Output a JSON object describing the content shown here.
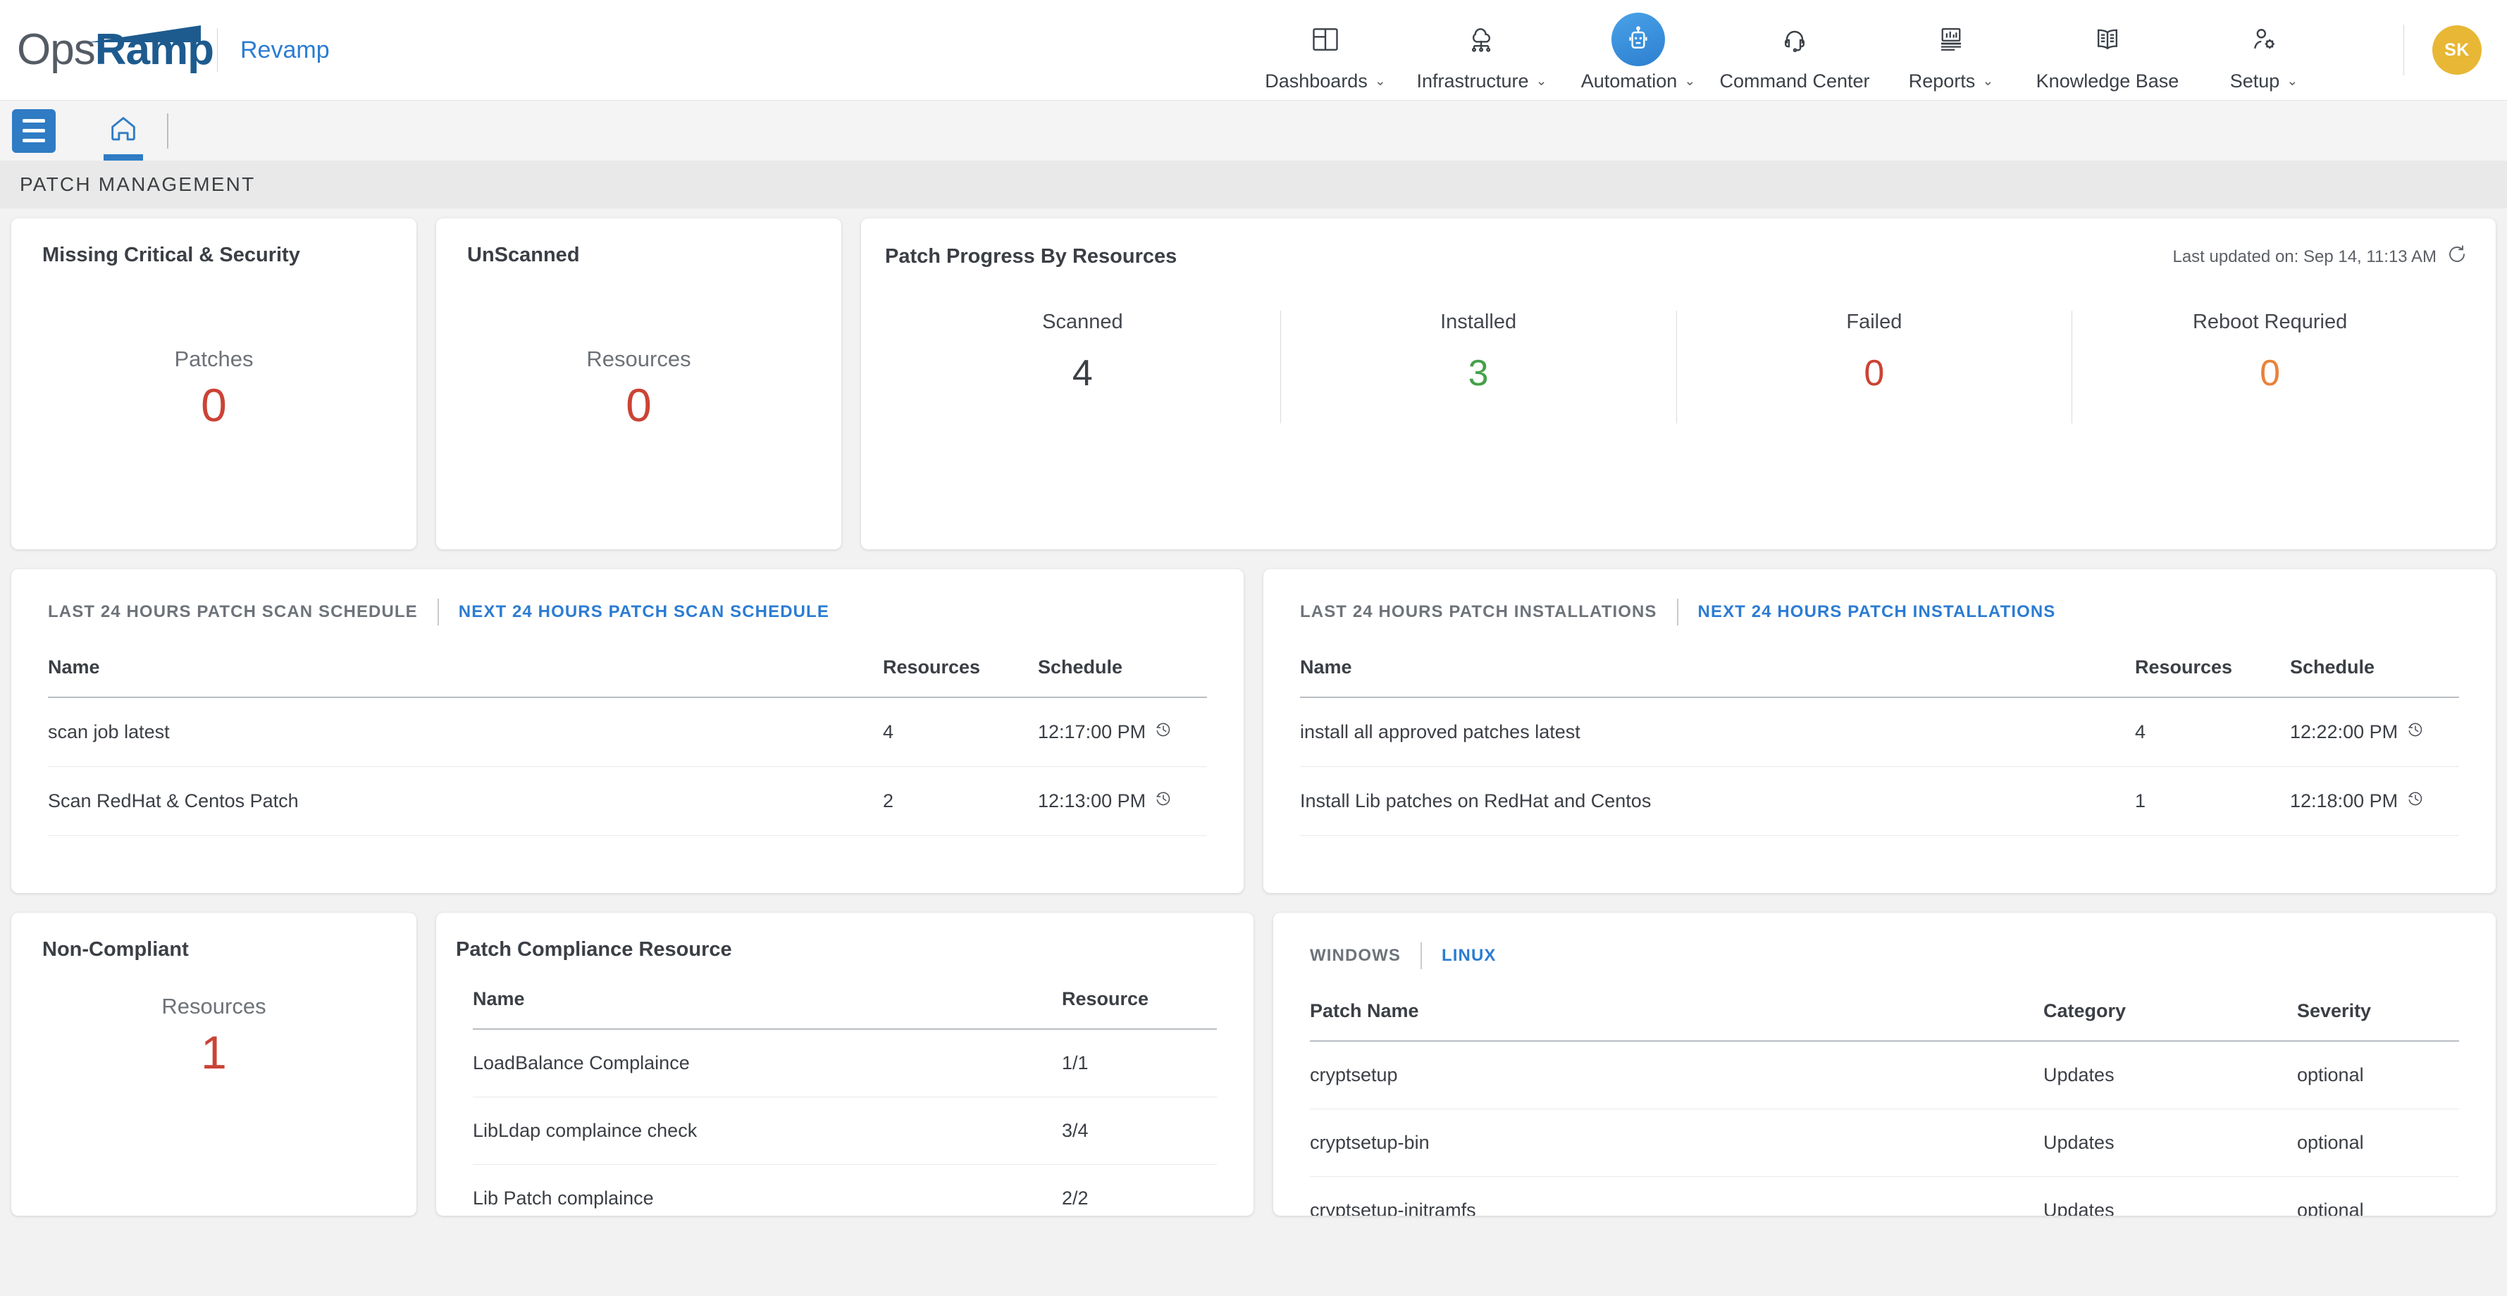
{
  "brand": {
    "name_light": "Ops",
    "name_bold": "Ramp",
    "sub": "Revamp"
  },
  "topnav": {
    "items": [
      {
        "label": "Dashboards",
        "icon": "dashboard-icon",
        "caret": "⌄",
        "active": false
      },
      {
        "label": "Infrastructure",
        "icon": "infrastructure-icon",
        "caret": "⌄",
        "active": false
      },
      {
        "label": "Automation",
        "icon": "robot-icon",
        "caret": "⌄",
        "active": true
      },
      {
        "label": "Command Center",
        "icon": "headset-icon",
        "caret": "",
        "active": false
      },
      {
        "label": "Reports",
        "icon": "report-icon",
        "caret": "⌄",
        "active": false
      },
      {
        "label": "Knowledge Base",
        "icon": "book-icon",
        "caret": "",
        "active": false
      },
      {
        "label": "Setup",
        "icon": "user-gear-icon",
        "caret": "⌄",
        "active": false
      }
    ],
    "avatar_initials": "SK",
    "avatar_color": "#e8b735"
  },
  "subbar": {
    "menu_icon": "hamburger-icon",
    "home_icon": "home-icon"
  },
  "page": {
    "title": "PATCH MANAGEMENT"
  },
  "colors": {
    "red": "#cb4335",
    "green": "#45a049",
    "orange": "#e8833a",
    "dark": "#3b3f45",
    "link": "#2b7cd3"
  },
  "kpi_cards": [
    {
      "title": "Missing Critical & Security",
      "label": "Patches",
      "value": "0",
      "color": "#cb4335"
    },
    {
      "title": "UnScanned",
      "label": "Resources",
      "value": "0",
      "color": "#cb4335"
    }
  ],
  "progress": {
    "title": "Patch Progress By Resources",
    "updated_text": "Last updated on: Sep 14, 11:13 AM",
    "refresh_icon": "refresh-icon",
    "stats": [
      {
        "label": "Scanned",
        "value": "4",
        "color": "#3b3f45"
      },
      {
        "label": "Installed",
        "value": "3",
        "color": "#45a049"
      },
      {
        "label": "Failed",
        "value": "0",
        "color": "#cb4335"
      },
      {
        "label": "Reboot Requried",
        "value": "0",
        "color": "#e8833a"
      }
    ]
  },
  "scan_schedule": {
    "tabs": [
      {
        "label": "LAST 24 HOURS PATCH SCAN SCHEDULE",
        "active": false
      },
      {
        "label": "NEXT 24 HOURS PATCH SCAN SCHEDULE",
        "active": true
      }
    ],
    "columns": [
      "Name",
      "Resources",
      "Schedule"
    ],
    "rows": [
      {
        "name": "scan job latest",
        "resources": "4",
        "schedule": "12:17:00 PM"
      },
      {
        "name": "Scan RedHat & Centos Patch",
        "resources": "2",
        "schedule": "12:13:00 PM"
      }
    ]
  },
  "installations": {
    "tabs": [
      {
        "label": "LAST 24 HOURS PATCH INSTALLATIONS",
        "active": false
      },
      {
        "label": "NEXT 24 HOURS PATCH INSTALLATIONS",
        "active": true
      }
    ],
    "columns": [
      "Name",
      "Resources",
      "Schedule"
    ],
    "rows": [
      {
        "name": "install all approved patches latest",
        "resources": "4",
        "schedule": "12:22:00 PM"
      },
      {
        "name": "Install Lib patches on RedHat and Centos",
        "resources": "1",
        "schedule": "12:18:00 PM"
      }
    ]
  },
  "non_compliant": {
    "title": "Non-Compliant",
    "label": "Resources",
    "value": "1",
    "color": "#cb4335"
  },
  "compliance_resource": {
    "title": "Patch Compliance Resource",
    "columns": [
      "Name",
      "Resource"
    ],
    "rows": [
      {
        "name": "LoadBalance Complaince",
        "resource": "1/1"
      },
      {
        "name": "LibLdap complaince check",
        "resource": "3/4"
      },
      {
        "name": "Lib Patch complaince",
        "resource": "2/2"
      }
    ]
  },
  "os_patches": {
    "tabs": [
      {
        "label": "WINDOWS",
        "active": false
      },
      {
        "label": "LINUX",
        "active": true
      }
    ],
    "columns": [
      "Patch Name",
      "Category",
      "Severity"
    ],
    "rows": [
      {
        "name": "cryptsetup",
        "category": "Updates",
        "severity": "optional"
      },
      {
        "name": "cryptsetup-bin",
        "category": "Updates",
        "severity": "optional"
      },
      {
        "name": "cryptsetup-initramfs",
        "category": "Updates",
        "severity": "optional"
      }
    ]
  }
}
